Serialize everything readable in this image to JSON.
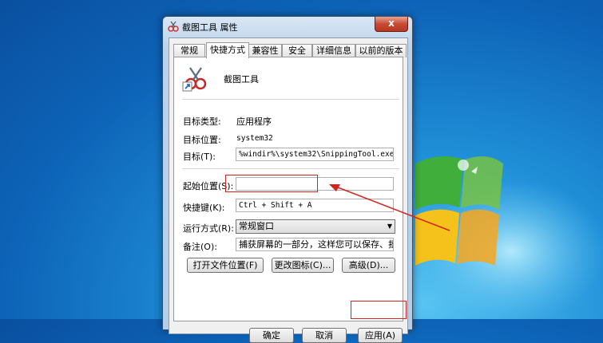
{
  "window": {
    "title": "截图工具 属性",
    "close_symbol": "x"
  },
  "tabs": [
    {
      "label": "常规"
    },
    {
      "label": "快捷方式"
    },
    {
      "label": "兼容性"
    },
    {
      "label": "安全"
    },
    {
      "label": "详细信息"
    },
    {
      "label": "以前的版本"
    }
  ],
  "app": {
    "name": "截图工具",
    "icon": "snipping-tool-icon"
  },
  "props": {
    "target_type_label": "目标类型:",
    "target_type_value": "应用程序",
    "target_location_label": "目标位置:",
    "target_location_value": "system32",
    "target_label": "目标(T):",
    "target_value": "%windir%\\system32\\SnippingTool.exe",
    "start_in_label": "起始位置(S):",
    "start_in_value": "",
    "shortcut_key_label": "快捷键(K):",
    "shortcut_key_value": "Ctrl + Shift + A",
    "run_label": "运行方式(R):",
    "run_value": "常规窗口",
    "comment_label": "备注(O):",
    "comment_value": "捕获屏幕的一部分，这样您可以保存、批注或"
  },
  "buttons": {
    "open_location": "打开文件位置(F)",
    "change_icon": "更改图标(C)...",
    "advanced": "高级(D)...",
    "ok": "确定",
    "cancel": "取消",
    "apply": "应用(A)"
  },
  "colors": {
    "highlight": "#d4231c",
    "desktop": "#1f8fd8"
  }
}
